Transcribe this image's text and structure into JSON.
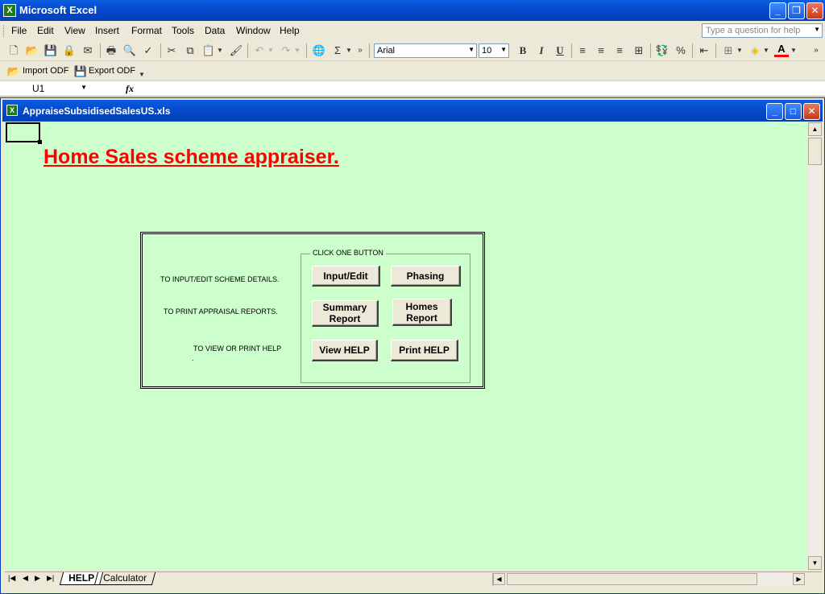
{
  "app": {
    "title": "Microsoft Excel",
    "icon": "excel-icon"
  },
  "window_controls": {
    "minimize": "_",
    "maximize": "❐",
    "close": "✕"
  },
  "menu": {
    "items": [
      "File",
      "Edit",
      "View",
      "Insert",
      "Format",
      "Tools",
      "Data",
      "Window",
      "Help"
    ],
    "help_placeholder": "Type a question for help"
  },
  "formatting": {
    "font_name": "Arial",
    "font_size": "10",
    "bold": "B",
    "italic": "I",
    "underline": "U"
  },
  "odf_toolbar": {
    "import_label": "Import ODF",
    "export_label": "Export ODF"
  },
  "formula_bar": {
    "name_box": "U1",
    "fx": "fx",
    "formula": ""
  },
  "workbook": {
    "title": "AppraiseSubsidisedSalesUS.xls",
    "controls": {
      "minimize": "_",
      "maximize": "□",
      "close": "✕"
    }
  },
  "sheet": {
    "heading": "Home Sales scheme appraiser.",
    "panel": {
      "group_label": "CLICK ONE BUTTON",
      "row_labels": [
        "TO INPUT/EDIT SCHEME DETAILS.",
        "TO PRINT APPRAISAL REPORTS.",
        "TO VIEW OR PRINT HELP"
      ],
      "dot": ".",
      "buttons": {
        "input_edit": "Input/Edit",
        "phasing": "Phasing",
        "summary_report": "Summary Report",
        "homes_report": "Homes Report",
        "view_help": "View HELP",
        "print_help": "Print HELP"
      }
    }
  },
  "tabs": {
    "items": [
      "HELP",
      "Calculator"
    ],
    "active": "HELP"
  },
  "colors": {
    "sheet_background": "#ccffcc",
    "heading": "#ff0000",
    "titlebar": "#0548c9"
  }
}
